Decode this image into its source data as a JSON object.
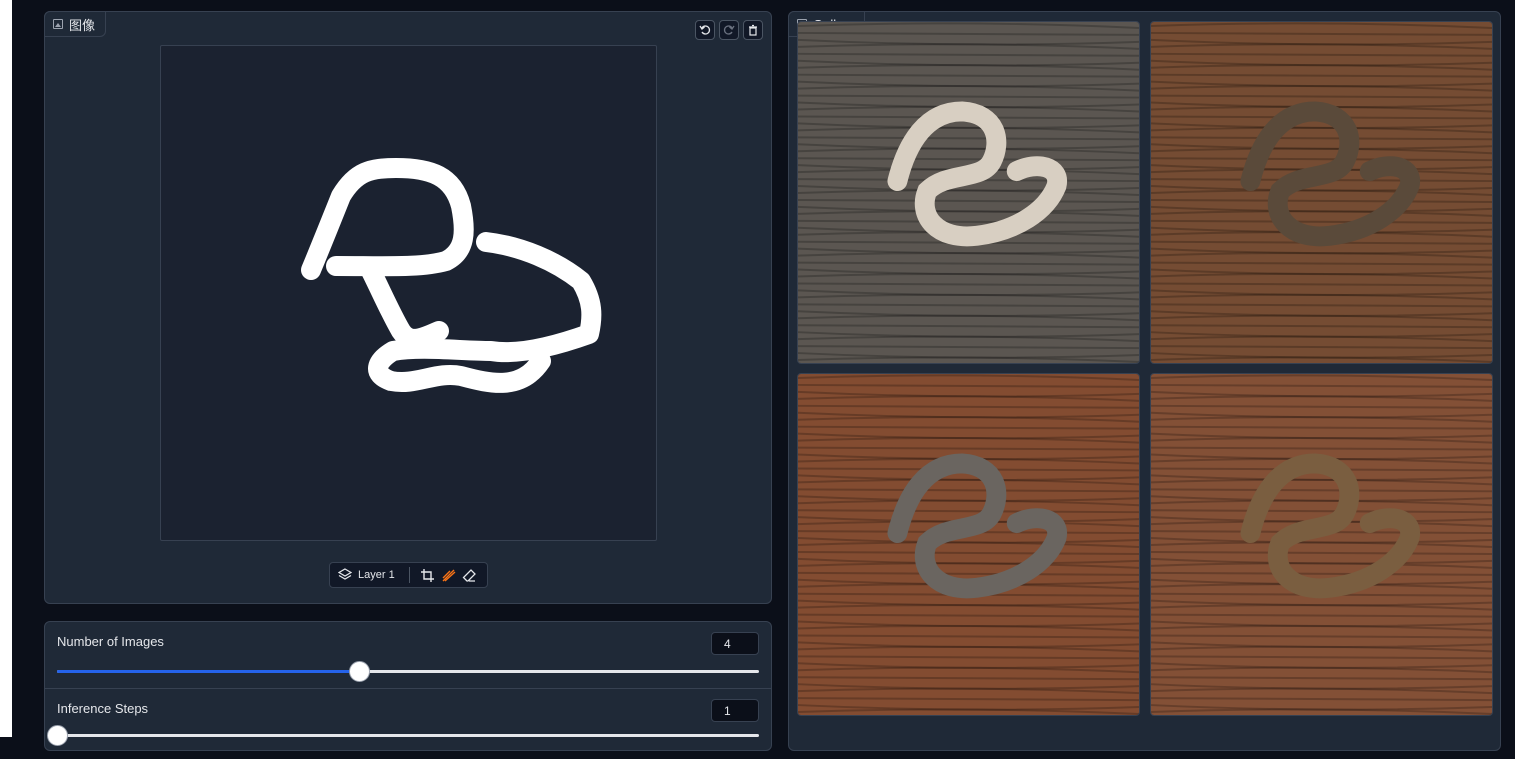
{
  "editor": {
    "label": "图像",
    "icon": "image-icon",
    "toolbar": {
      "undo_icon": "undo-icon",
      "redo_icon": "redo-icon",
      "clear_icon": "trash-icon"
    },
    "layer_bar": {
      "layer_label": "Layer 1",
      "tools": [
        "layers-icon",
        "crop-icon",
        "brush-icon",
        "eraser-icon"
      ],
      "active_tool": "brush",
      "brush_color": "#f97316"
    },
    "sketch_color": "#ffffff"
  },
  "settings": {
    "num_images": {
      "label": "Number of Images",
      "value": "4",
      "fraction": 0.43
    },
    "inference_steps": {
      "label": "Inference Steps",
      "value": "1",
      "fraction": 0.0
    }
  },
  "gallery": {
    "label": "Gallery",
    "icon": "image-icon",
    "share_icon": "share-icon",
    "images": [
      {
        "name": "gallery-image-1",
        "wood": "#6b6660",
        "rope": "#d8cfc2"
      },
      {
        "name": "gallery-image-2",
        "wood": "#8a5a3c",
        "rope": "#5a4a3a"
      },
      {
        "name": "gallery-image-3",
        "wood": "#9a5a3a",
        "rope": "#6a6560"
      },
      {
        "name": "gallery-image-4",
        "wood": "#9a5e40",
        "rope": "#7a5e40"
      }
    ]
  },
  "colors": {
    "background": "#0b0f19",
    "panel": "#1f2937",
    "accent": "#2563eb"
  }
}
